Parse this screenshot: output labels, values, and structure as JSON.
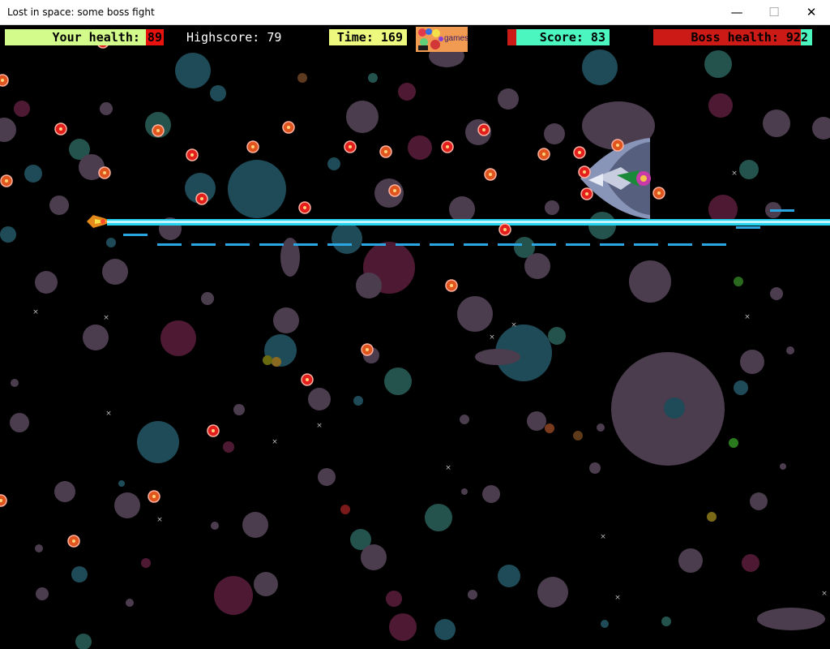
{
  "window": {
    "title": "Lost in space: some boss fight",
    "minimize_glyph": "—",
    "maximize_glyph": "☐",
    "close_glyph": "✕"
  },
  "hud": {
    "health_label": "Your health: 89",
    "health_fraction": 0.89,
    "highscore_label": "Highscore: 79",
    "time_label": "Time: 169",
    "logo_text": "games",
    "score_label": "Score: 83",
    "boss_health_label": "Boss health: 922",
    "boss_health_fraction": 0.07
  },
  "colors": {
    "laser": "#25d3ee",
    "laser_dash": "#2aa7e3",
    "enemy_bullet_red": "#e31e1c",
    "enemy_bullet_orange": "#e0541e",
    "boss_hull": "#8895b8"
  }
}
